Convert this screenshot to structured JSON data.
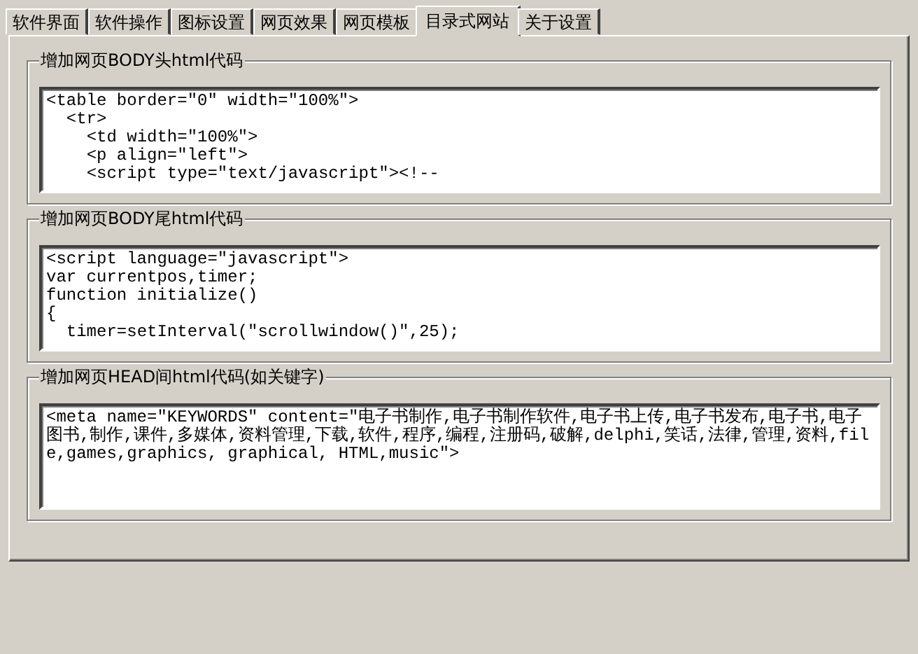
{
  "tabs": [
    {
      "label": "软件界面",
      "selected": false
    },
    {
      "label": "软件操作",
      "selected": false
    },
    {
      "label": "图标设置",
      "selected": false
    },
    {
      "label": "网页效果",
      "selected": false
    },
    {
      "label": "网页模板",
      "selected": false
    },
    {
      "label": "目录式网站",
      "selected": true
    },
    {
      "label": "关于设置",
      "selected": false
    }
  ],
  "groups": [
    {
      "legend": "增加网页BODY头html代码",
      "lines": [
        "<table border=\"0\" width=\"100%\">",
        "  <tr>",
        "    <td width=\"100%\">",
        "    <p align=\"left\">",
        "    <script type=\"text/javascript\"><!--"
      ]
    },
    {
      "legend": "增加网页BODY尾html代码",
      "lines": [
        "<script language=\"javascript\">",
        "var currentpos,timer;",
        "function initialize()",
        "{",
        "  timer=setInterval(\"scrollwindow()\",25);"
      ]
    },
    {
      "legend": "增加网页HEAD间html代码(如关键字)",
      "lines": [
        "<meta name=\"KEYWORDS\" content=\"电子书制作,电子书制作软件,电子书上传,电子书发布,电子书,电子图书,制作,课件,多媒体,资料管理,下载,软件,程序,编程,注册码,破解,delphi,笑话,法律,管理,资料,file,games,graphics, graphical, HTML,music\">"
      ]
    }
  ]
}
